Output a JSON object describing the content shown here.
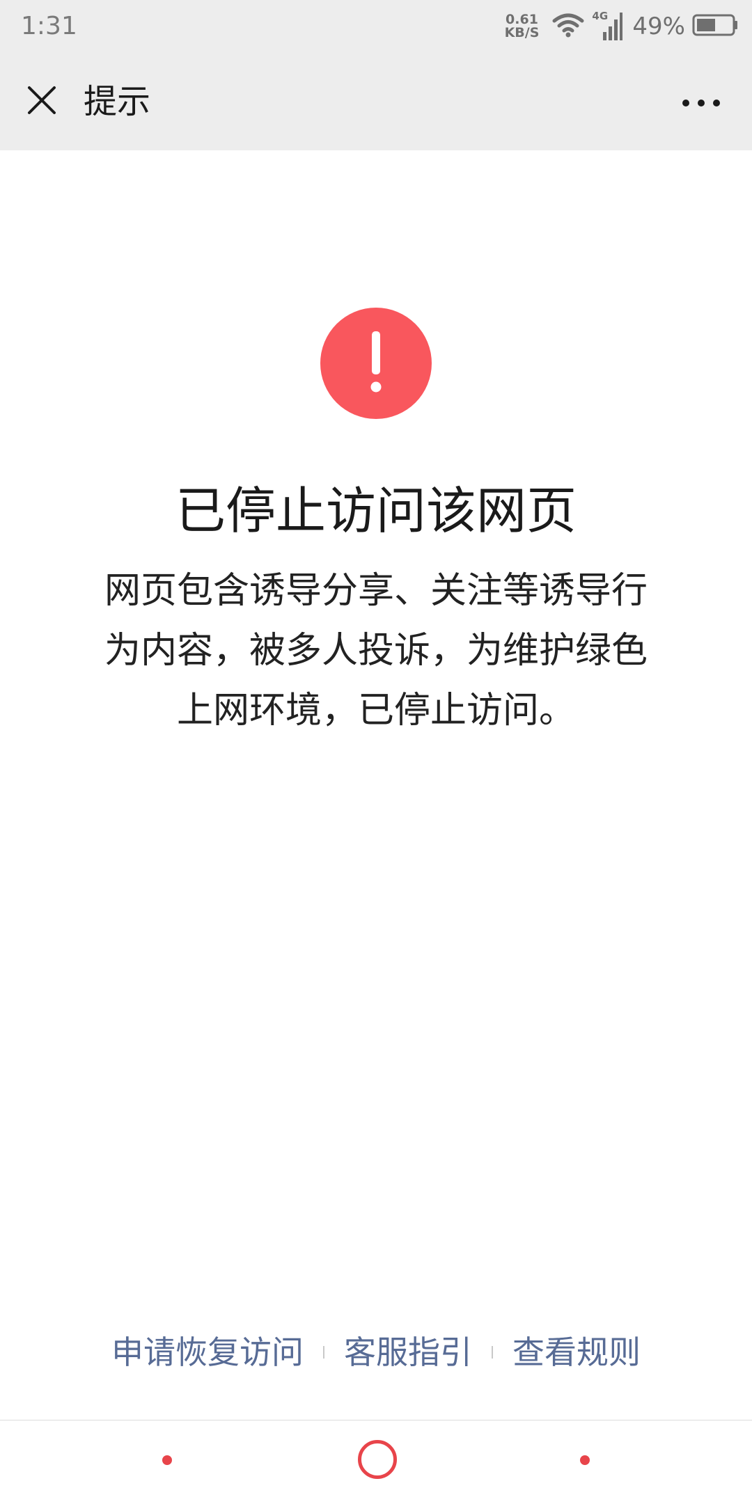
{
  "status_bar": {
    "time": "1:31",
    "net_speed_value": "0.61",
    "net_speed_unit": "KB/S",
    "signal_label": "4G",
    "battery_percent": "49%"
  },
  "title_bar": {
    "close_icon": "close-icon",
    "title": "提示",
    "more_icon": "more-icon"
  },
  "main": {
    "icon": "alert-icon",
    "icon_color": "#f9575d",
    "title": "已停止访问该网页",
    "description_lines": [
      "网页包含诱导分享、关注等诱导行",
      "为内容，被多人投诉，为维护绿色",
      "上网环境，已停止访问。"
    ]
  },
  "footer": {
    "links": [
      {
        "label": "申请恢复访问"
      },
      {
        "label": "客服指引"
      },
      {
        "label": "查看规则"
      }
    ],
    "link_color": "#576b95"
  },
  "nav_bar": {
    "accent": "#e8444a",
    "items": [
      "back-dot",
      "home-circle",
      "recent-dot"
    ]
  }
}
